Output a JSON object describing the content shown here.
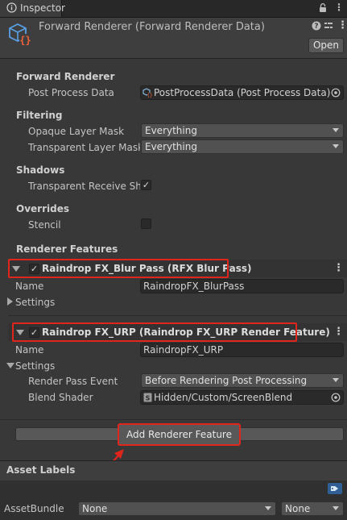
{
  "tab": {
    "label": "Inspector"
  },
  "header": {
    "title": "Forward Renderer (Forward Renderer Data)",
    "open_label": "Open"
  },
  "forward_renderer": {
    "section": "Forward Renderer",
    "post_process_label": "Post Process Data",
    "post_process_value": "PostProcessData (Post Process Data)"
  },
  "filtering": {
    "section": "Filtering",
    "opaque_label": "Opaque Layer Mask",
    "opaque_value": "Everything",
    "transparent_label": "Transparent Layer Mask",
    "transparent_value": "Everything"
  },
  "shadows": {
    "section": "Shadows",
    "receive_label": "Transparent Receive Sha",
    "receive_checked": true
  },
  "overrides": {
    "section": "Overrides",
    "stencil_label": "Stencil",
    "stencil_checked": false
  },
  "renderer_features": {
    "section": "Renderer Features",
    "features": [
      {
        "title": "Raindrop FX_Blur Pass (RFX Blur Pass)",
        "name_label": "Name",
        "name_value": "RaindropFX_BlurPass",
        "settings_label": "Settings"
      },
      {
        "title": "Raindrop FX_URP (Raindrop FX_URP Render Feature)",
        "name_label": "Name",
        "name_value": "RaindropFX_URP",
        "settings_label": "Settings",
        "render_pass_event_label": "Render Pass Event",
        "render_pass_event_value": "Before Rendering Post Processing",
        "blend_shader_label": "Blend Shader",
        "blend_shader_value": "Hidden/Custom/ScreenBlend"
      }
    ],
    "add_button": "Add Renderer Feature"
  },
  "asset_labels": {
    "title": "Asset Labels",
    "assetbundle_label": "AssetBundle",
    "assetbundle_value": "None",
    "variant_value": "None"
  },
  "colors": {
    "highlight": "#e0261c",
    "background": "#383838",
    "accent_icon": "#4a8fd8"
  }
}
